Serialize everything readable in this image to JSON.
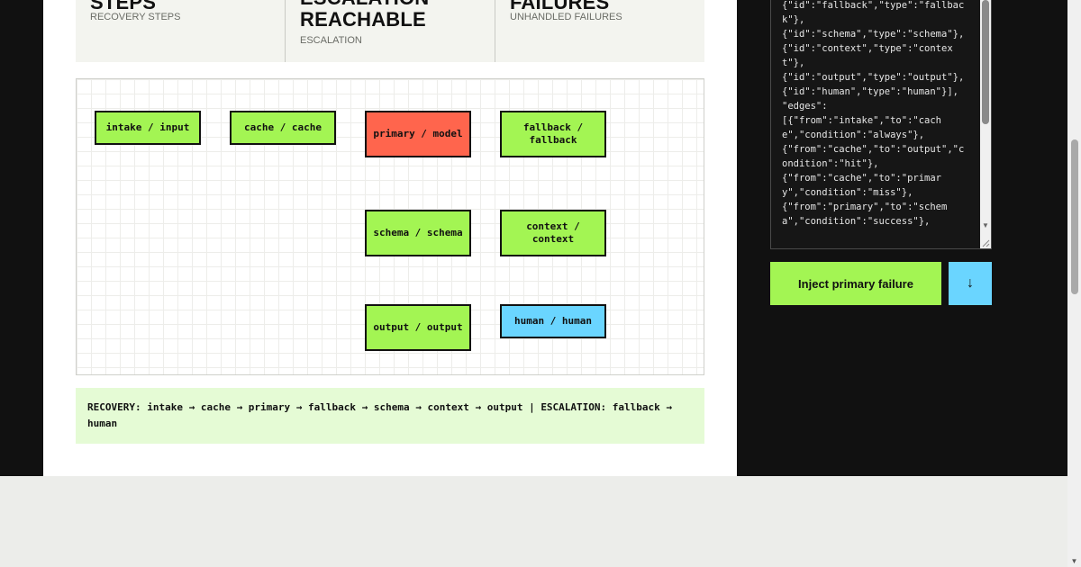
{
  "stats": [
    {
      "value": "STEPS",
      "caption": "RECOVERY STEPS"
    },
    {
      "value": "ESCALATION\nREACHABLE",
      "caption": "ESCALATION"
    },
    {
      "value": "FAILURES",
      "caption": "UNHANDLED FAILURES"
    }
  ],
  "graph": {
    "nodes": [
      {
        "label": "intake / input",
        "status": "ok"
      },
      {
        "label": "cache / cache",
        "status": "ok"
      },
      {
        "label": "primary / model",
        "status": "failed"
      },
      {
        "label": "fallback / fallback",
        "status": "ok"
      },
      {
        "label": "schema / schema",
        "status": "ok"
      },
      {
        "label": "context / context",
        "status": "ok"
      },
      {
        "label": "output / output",
        "status": "ok"
      },
      {
        "label": "human / human",
        "status": "escalation"
      }
    ]
  },
  "trace": {
    "text": "RECOVERY: intake → cache → primary → fallback → schema → context → output | ESCALATION: fallback → human"
  },
  "editor": {
    "content": "{\"id\":\"fallback\",\"type\":\"fallback\"},\n{\"id\":\"schema\",\"type\":\"schema\"},\n{\"id\":\"context\",\"type\":\"context\"},\n{\"id\":\"output\",\"type\":\"output\"},\n{\"id\":\"human\",\"type\":\"human\"}],\n\"edges\":\n[{\"from\":\"intake\",\"to\":\"cache\",\"condition\":\"always\"},\n{\"from\":\"cache\",\"to\":\"output\",\"condition\":\"hit\"},\n{\"from\":\"cache\",\"to\":\"primary\",\"condition\":\"miss\"},\n{\"from\":\"primary\",\"to\":\"schema\",\"condition\":\"success\"},"
  },
  "actions": {
    "inject_label": "Inject primary failure",
    "down_label": "↓"
  },
  "colors": {
    "ok": "#a3f553",
    "failed": "#ff654d",
    "escalation": "#6ad5ff"
  }
}
